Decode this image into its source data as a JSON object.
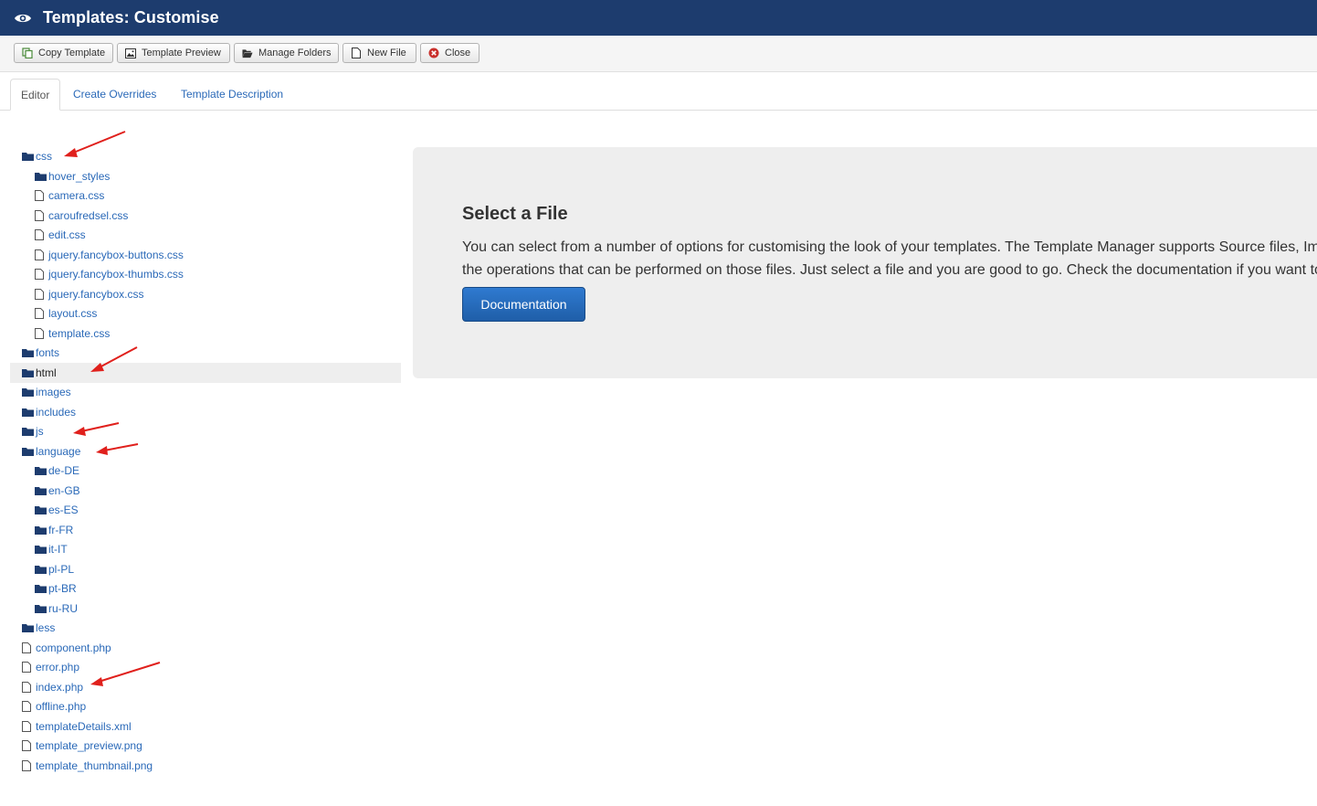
{
  "header": {
    "title": "Templates: Customise",
    "icon": "eye-icon"
  },
  "toolbar": {
    "buttons": [
      {
        "label": "Copy Template",
        "icon": "copy-icon"
      },
      {
        "label": "Template Preview",
        "icon": "image-icon"
      },
      {
        "label": "Manage Folders",
        "icon": "folder-open-icon"
      },
      {
        "label": "New File",
        "icon": "file-icon"
      },
      {
        "label": "Close",
        "icon": "close-circle-icon"
      }
    ]
  },
  "tabs": [
    {
      "label": "Editor",
      "active": true
    },
    {
      "label": "Create Overrides",
      "active": false
    },
    {
      "label": "Template Description",
      "active": false
    }
  ],
  "tree": [
    {
      "label": "css",
      "type": "folder",
      "depth": 0
    },
    {
      "label": "hover_styles",
      "type": "folder",
      "depth": 1
    },
    {
      "label": "camera.css",
      "type": "file",
      "depth": 1
    },
    {
      "label": "caroufredsel.css",
      "type": "file",
      "depth": 1
    },
    {
      "label": "edit.css",
      "type": "file",
      "depth": 1
    },
    {
      "label": "jquery.fancybox-buttons.css",
      "type": "file",
      "depth": 1
    },
    {
      "label": "jquery.fancybox-thumbs.css",
      "type": "file",
      "depth": 1
    },
    {
      "label": "jquery.fancybox.css",
      "type": "file",
      "depth": 1
    },
    {
      "label": "layout.css",
      "type": "file",
      "depth": 1
    },
    {
      "label": "template.css",
      "type": "file",
      "depth": 1
    },
    {
      "label": "fonts",
      "type": "folder",
      "depth": 0
    },
    {
      "label": "html",
      "type": "folder",
      "depth": 0,
      "selected": true
    },
    {
      "label": "images",
      "type": "folder",
      "depth": 0
    },
    {
      "label": "includes",
      "type": "folder",
      "depth": 0
    },
    {
      "label": "js",
      "type": "folder",
      "depth": 0
    },
    {
      "label": "language",
      "type": "folder",
      "depth": 0
    },
    {
      "label": "de-DE",
      "type": "folder",
      "depth": 1
    },
    {
      "label": "en-GB",
      "type": "folder",
      "depth": 1
    },
    {
      "label": "es-ES",
      "type": "folder",
      "depth": 1
    },
    {
      "label": "fr-FR",
      "type": "folder",
      "depth": 1
    },
    {
      "label": "it-IT",
      "type": "folder",
      "depth": 1
    },
    {
      "label": "pl-PL",
      "type": "folder",
      "depth": 1
    },
    {
      "label": "pt-BR",
      "type": "folder",
      "depth": 1
    },
    {
      "label": "ru-RU",
      "type": "folder",
      "depth": 1
    },
    {
      "label": "less",
      "type": "folder",
      "depth": 0
    },
    {
      "label": "component.php",
      "type": "file",
      "depth": 0
    },
    {
      "label": "error.php",
      "type": "file",
      "depth": 0
    },
    {
      "label": "index.php",
      "type": "file",
      "depth": 0
    },
    {
      "label": "offline.php",
      "type": "file",
      "depth": 0
    },
    {
      "label": "templateDetails.xml",
      "type": "file",
      "depth": 0
    },
    {
      "label": "template_preview.png",
      "type": "file",
      "depth": 0
    },
    {
      "label": "template_thumbnail.png",
      "type": "file",
      "depth": 0
    }
  ],
  "panel": {
    "heading": "Select a File",
    "line1": "You can select from a number of options for customising the look of your templates. The Template Manager supports Source files, Images",
    "line2": "the operations that can be performed on those files. Just select a file and you are good to go. Check the documentation if you want to",
    "button_label": "Documentation"
  },
  "colors": {
    "header_bg": "#1d3c6e",
    "link": "#2a69b8",
    "primary_button": "#2a6dbf",
    "annotation_arrow": "#e0201c"
  }
}
